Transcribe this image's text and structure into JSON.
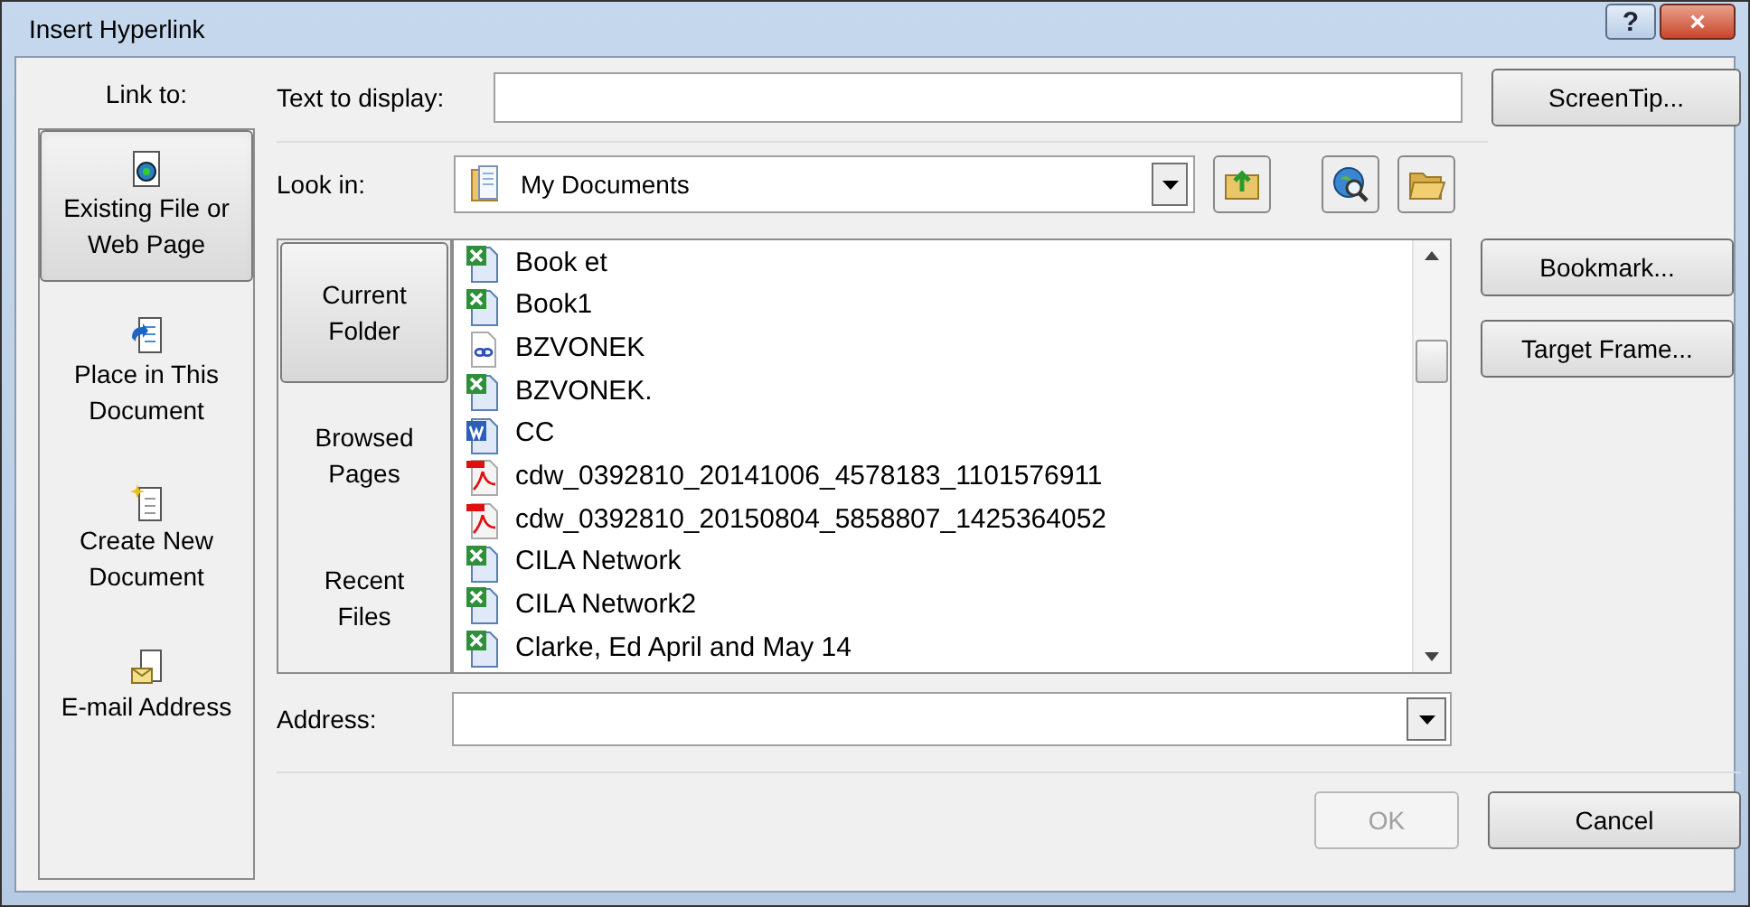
{
  "window": {
    "title": "Insert Hyperlink",
    "buttons": [
      {
        "kind": "help",
        "label": "?"
      },
      {
        "kind": "close",
        "label": "×"
      }
    ]
  },
  "link_to": {
    "label": "Link to:",
    "items": [
      {
        "kind": "file",
        "label": "Existing File or Web Page",
        "selected": true
      },
      {
        "kind": "place",
        "label": "Place in This Document",
        "selected": false
      },
      {
        "kind": "new",
        "label": "Create New Document",
        "selected": false
      },
      {
        "kind": "email",
        "label": "E-mail Address",
        "selected": false
      }
    ]
  },
  "text_to_display": {
    "label": "Text to display:"
  },
  "screentip_button": "ScreenTip...",
  "look_in": {
    "label": "Look in:",
    "value": "My Documents"
  },
  "browse_tabs": [
    {
      "label": "Current Folder",
      "selected": true
    },
    {
      "label": "Browsed Pages",
      "selected": false
    },
    {
      "label": "Recent Files",
      "selected": false
    }
  ],
  "files": [
    {
      "kind": "excel",
      "name": "Book et"
    },
    {
      "kind": "excel",
      "name": "Book1"
    },
    {
      "kind": "link",
      "name": "BZVONEK"
    },
    {
      "kind": "excel",
      "name": "BZVONEK."
    },
    {
      "kind": "word",
      "name": "CC"
    },
    {
      "kind": "pdf",
      "name": "cdw_0392810_20141006_4578183_1101576911"
    },
    {
      "kind": "pdf",
      "name": "cdw_0392810_20150804_5858807_1425364052"
    },
    {
      "kind": "excel",
      "name": "CILA Network"
    },
    {
      "kind": "excel",
      "name": "CILA Network2"
    },
    {
      "kind": "excel",
      "name": "Clarke, Ed April and May 14"
    }
  ],
  "side_buttons": [
    "Bookmark...",
    "Target Frame..."
  ],
  "address": {
    "label": "Address:"
  },
  "footer_buttons": [
    {
      "label": "OK",
      "disabled": true
    },
    {
      "label": "Cancel",
      "disabled": false
    }
  ]
}
